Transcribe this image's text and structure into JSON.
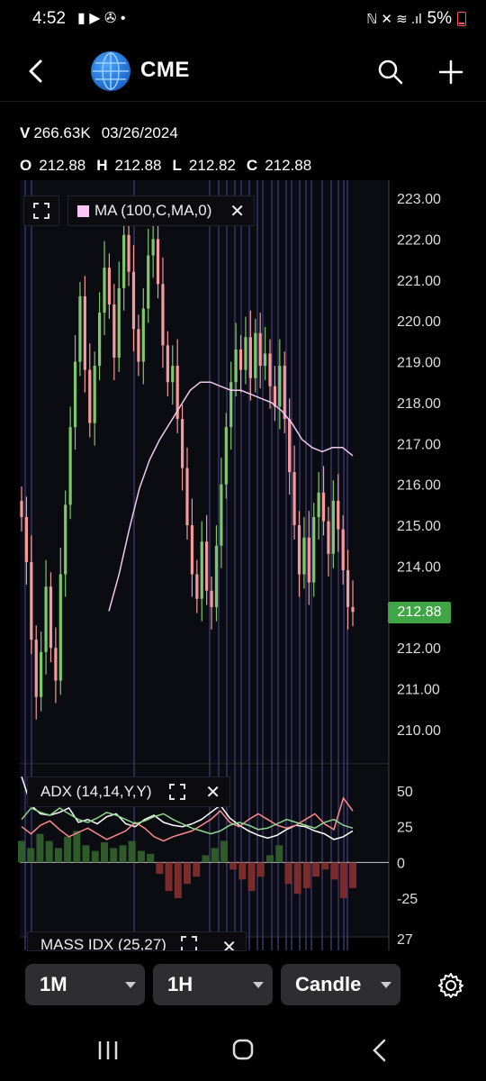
{
  "status_bar": {
    "time": "4:52",
    "left_icons": "▮ ▶ ✇ •",
    "signal": "ℕ ✕ ≋ .ıl",
    "battery": "5%"
  },
  "header": {
    "ticker": "CME"
  },
  "quote": {
    "v_label": "V",
    "v_value": "266.63K",
    "date": "03/26/2024",
    "o_label": "O",
    "o_value": "212.88",
    "h_label": "H",
    "h_value": "212.88",
    "l_label": "L",
    "l_value": "212.82",
    "c_label": "C",
    "c_value": "212.88"
  },
  "indicators": {
    "ma_label": "MA (100,C,MA,0)",
    "adx_label": "ADX (14,14,Y,Y)",
    "mass_label": "MASS IDX (25,27)"
  },
  "price_tag": "212.88",
  "chart_data": [
    {
      "type": "candlestick",
      "title": "",
      "ylim": [
        210,
        223
      ],
      "y_ticks": [
        "223.00",
        "222.00",
        "221.00",
        "220.00",
        "219.00",
        "218.00",
        "217.00",
        "216.00",
        "215.00",
        "214.00",
        "213.00",
        "212.00",
        "211.00",
        "210.00"
      ],
      "current_price": 212.88,
      "close_series": [
        215.2,
        214.1,
        212.2,
        210.8,
        211.9,
        213.5,
        212.0,
        211.2,
        213.8,
        215.5,
        217.4,
        219.0,
        220.6,
        218.8,
        217.5,
        218.9,
        220.2,
        221.3,
        220.4,
        219.1,
        220.8,
        222.1,
        221.2,
        219.8,
        219.0,
        220.3,
        221.6,
        222.0,
        220.9,
        219.4,
        218.5,
        218.9,
        217.6,
        216.4,
        215.0,
        213.8,
        213.2,
        214.6,
        213.4,
        213.0,
        214.5,
        216.0,
        217.4,
        218.5,
        219.3,
        218.8,
        219.6,
        218.6,
        219.7,
        218.9,
        219.2,
        218.4,
        217.9,
        218.9,
        217.6,
        216.3,
        215.0,
        213.8,
        214.7,
        213.6,
        215.2,
        215.8,
        215.1,
        214.3,
        215.6,
        214.9,
        213.9,
        213.0,
        212.88
      ],
      "ma_series": [
        212.9,
        213.8,
        214.9,
        215.9,
        216.6,
        217.1,
        217.5,
        217.9,
        218.3,
        218.5,
        218.5,
        218.4,
        218.3,
        218.3,
        218.2,
        218.1,
        218.0,
        217.8,
        217.5,
        217.1,
        216.9,
        216.8,
        216.9,
        216.9,
        216.7
      ],
      "ma_color": "#f0c8f0"
    },
    {
      "type": "line",
      "title": "",
      "ylim": [
        -30,
        50
      ],
      "y_ticks": [
        "50",
        "25",
        "0",
        "-25"
      ],
      "series": [
        {
          "color": "#ffffff",
          "values": [
            60,
            40,
            34,
            33,
            35,
            38,
            28,
            30,
            27,
            32,
            34,
            27,
            25,
            30,
            33,
            28,
            26,
            25,
            27,
            30,
            35,
            40,
            31,
            26,
            22,
            19,
            17,
            19,
            23,
            26,
            25,
            22,
            20,
            16,
            18,
            22
          ]
        },
        {
          "color": "#ff8a8a",
          "values": [
            25,
            20,
            26,
            29,
            23,
            18,
            21,
            24,
            20,
            16,
            19,
            22,
            28,
            24,
            18,
            15,
            18,
            20,
            22,
            26,
            30,
            36,
            28,
            25,
            30,
            34,
            30,
            26,
            24,
            26,
            30,
            34,
            27,
            23,
            45,
            36
          ]
        },
        {
          "color": "#8bd78b",
          "values": [
            30,
            38,
            35,
            33,
            38,
            34,
            30,
            28,
            31,
            35,
            33,
            30,
            27,
            29,
            32,
            34,
            30,
            27,
            24,
            22,
            20,
            22,
            26,
            28,
            26,
            23,
            24,
            27,
            30,
            28,
            26,
            24,
            28,
            30,
            26,
            24
          ]
        }
      ],
      "histogram": [
        15,
        10,
        20,
        15,
        10,
        18,
        22,
        12,
        8,
        14,
        10,
        12,
        15,
        8,
        6,
        -8,
        -20,
        -25,
        -15,
        -10,
        5,
        10,
        15,
        -5,
        -12,
        -20,
        -10,
        5,
        12,
        -15,
        -22,
        -18,
        -10,
        -5,
        -12,
        -25,
        -18
      ]
    },
    {
      "type": "line",
      "title": "",
      "y_ticks": [
        "27"
      ],
      "series": []
    }
  ],
  "timeframe_buttons": [
    {
      "label": "1M"
    },
    {
      "label": "1H"
    },
    {
      "label": "Candle"
    }
  ]
}
